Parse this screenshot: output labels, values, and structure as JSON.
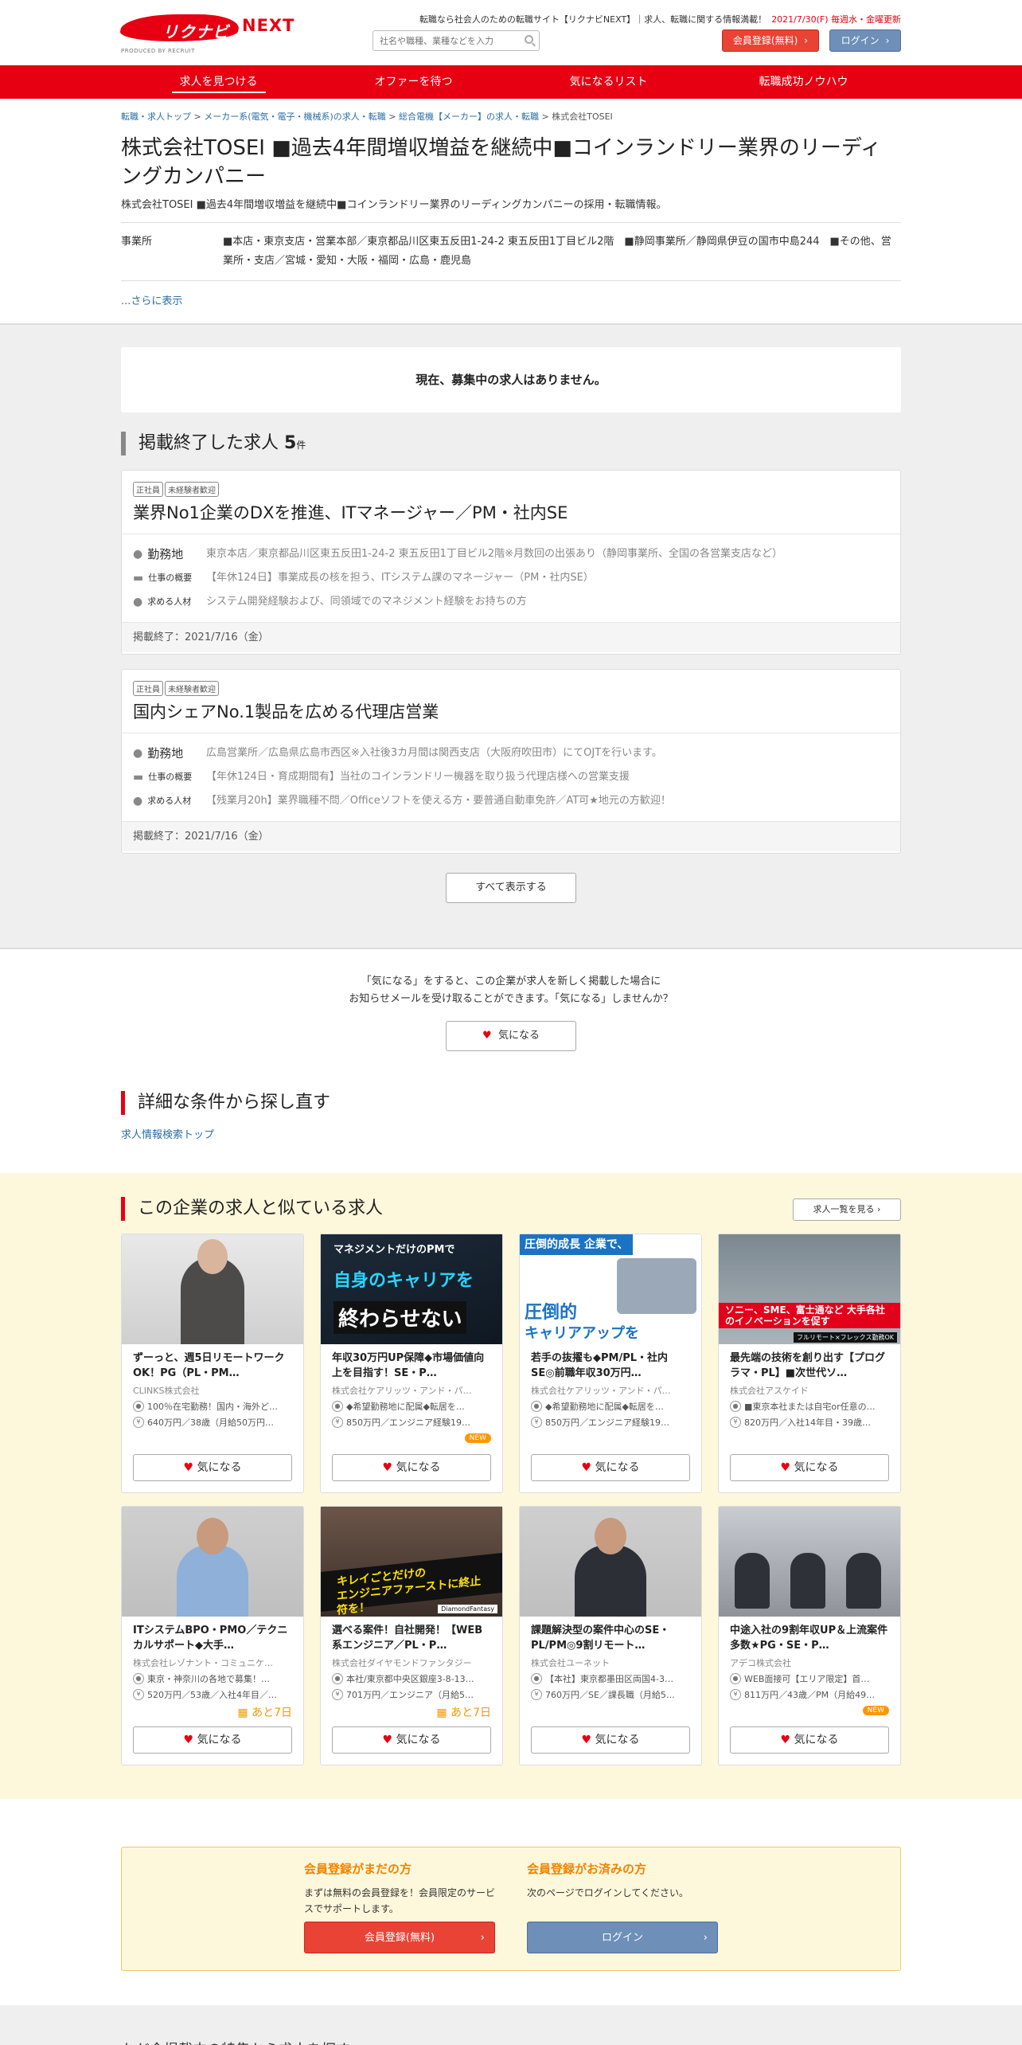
{
  "header": {
    "logo_text": "リクナビ",
    "logo_next": "NEXT",
    "logo_sub": "PRODUCED BY RECRUIT",
    "tagline": "転職なら社会人のための転職サイト【リクナビNEXT】｜求人、転職に関する情報満載！",
    "update": "2021/7/30(F) 毎週水・金曜更新",
    "search_placeholder": "社名や職種、業種などを入力",
    "register_label": "会員登録(無料)",
    "login_label": "ログイン"
  },
  "nav": [
    "求人を見つける",
    "オファーを待つ",
    "気になるリスト",
    "転職成功ノウハウ"
  ],
  "breadcrumb": {
    "items": [
      "転職・求人トップ",
      "メーカー系(電気・電子・機械系)の求人・転職",
      "総合電機【メーカー】の求人・転職"
    ],
    "current": "株式会社TOSEI"
  },
  "company": {
    "title": "株式会社TOSEI ■過去4年間増収増益を継続中■コインランドリー業界のリーディングカンパニー",
    "subtitle": "株式会社TOSEI ■過去4年間増収増益を継続中■コインランドリー業界のリーディングカンパニーの採用・転職情報。",
    "office_label": "事業所",
    "office_value": "■本店・東京支店・営業本部／東京都品川区東五反田1-24-2 東五反田1丁目ビル2階　■静岡事業所／静岡県伊豆の国市中島244　■その他、営業所・支店／宮城・愛知・大阪・福岡・広島・鹿児島",
    "more_label": "...さらに表示"
  },
  "jobs": {
    "no_jobs": "現在、募集中の求人はありません。",
    "ended_title": "掲載終了した求人",
    "ended_count": "5",
    "ended_unit": "件",
    "labels": {
      "location": "勤務地",
      "overview": "仕事の概要",
      "seeking": "求める人材"
    },
    "items": [
      {
        "tags": [
          "正社員",
          "未経験者歓迎"
        ],
        "title": "業界No1企業のDXを推進、ITマネージャー／PM・社内SE",
        "location": "東京本店／東京都品川区東五反田1-24-2 東五反田1丁目ビル2階※月数回の出張あり（静岡事業所、全国の各営業支店など）",
        "overview": "【年休124日】事業成長の核を担う、ITシステム課のマネージャー（PM・社内SE）",
        "seeking": "システム開発経験および、同領域でのマネジメント経験をお持ちの方",
        "ended": "掲載終了：2021/7/16（金）"
      },
      {
        "tags": [
          "正社員",
          "未経験者歓迎"
        ],
        "title": "国内シェアNo.1製品を広める代理店営業",
        "location": "広島営業所／広島県広島市西区※入社後3カ月間は関西支店（大阪府吹田市）にてOJTを行います。",
        "overview": "【年休124日・育成期間有】当社のコインランドリー機器を取り扱う代理店様への営業支援",
        "seeking": "【残業月20h】業界職種不問／Officeソフトを使える方・要普通自動車免許／AT可★地元の方歓迎！",
        "ended": "掲載終了：2021/7/16（金）"
      }
    ],
    "show_all": "すべて表示する"
  },
  "favorite": {
    "line1": "「気になる」をすると、この企業が求人を新しく掲載した場合に",
    "line2": "お知らせメールを受け取ることができます。「気になる」しませんか？",
    "button": "気になる"
  },
  "detail_search": {
    "title": "詳細な条件から探し直す",
    "link": "求人情報検索トップ"
  },
  "similar": {
    "title": "この企業の求人と似ている求人",
    "list_button": "求人一覧を見る",
    "fav_label": "気になる",
    "cards": [
      {
        "title": "ずーっと、週5日リモートワークOK！PG（PL・PM…",
        "company": "CLINKS株式会社",
        "loc": "100％在宅勤務！国内・海外ど…",
        "salary": "640万円／38歳（月給50万円…",
        "badge": "",
        "days": ""
      },
      {
        "title": "年収30万円UP保障◆市場価値向上を目指す！SE・P…",
        "company": "株式会社ケアリッツ・アンド・パ…",
        "loc": "◆希望勤務地に配属◆転居を…",
        "salary": "850万円／エンジニア経験19…",
        "badge": "NEW",
        "days": "",
        "art": {
          "l1": "マネジメントだけのPMで",
          "l2": "自身のキャリアを",
          "l3": "終わらせない"
        }
      },
      {
        "title": "若手の抜擢も◆PM/PL・社内SE◎前職年収30万円…",
        "company": "株式会社ケアリッツ・アンド・パ…",
        "loc": "◆希望勤務地に配属◆転居を…",
        "salary": "850万円／エンジニア経験19…",
        "badge": "",
        "days": "",
        "art": {
          "l1": "圧倒的成長 企業で、",
          "l2": "圧倒的",
          "l3": "キャリアアップを"
        }
      },
      {
        "title": "最先端の技術を創り出す【プログラマ・PL】■次世代ソ…",
        "company": "株式会社アスケイド",
        "loc": "■東京本社または自宅or任意の…",
        "salary": "820万円／入社14年目・39歳…",
        "badge": "",
        "days": "",
        "art": {
          "band": "ソニー、SME、富士通など 大手各社のイノベーションを促す",
          "sm": "フルリモート×フレックス勤務OK"
        }
      },
      {
        "title": "ITシステムBPO・PMO／テクニカルサポート◆大手…",
        "company": "株式会社レゾナント・コミュニケ…",
        "loc": "東京・神奈川の各地で募集！…",
        "salary": "520万円／53歳／入社4年目／…",
        "badge": "",
        "days": "あと7日"
      },
      {
        "title": "選べる案件！自社開発！【WEB系エンジニア／PL・P…",
        "company": "株式会社ダイヤモンドファンタジー",
        "loc": "本社/東京都中央区銀座3-8-13…",
        "salary": "701万円／エンジニア（月給5…",
        "badge": "",
        "days": "あと7日",
        "art": {
          "a": "キレイごとだけの",
          "b": "エンジニアファーストに終止符を！",
          "logo": "DiamondFantasy"
        }
      },
      {
        "title": "課題解決型の案件中心のSE・PL/PM◎9割リモート…",
        "company": "株式会社ユーネット",
        "loc": "【本社】東京都墨田区両国4-3…",
        "salary": "760万円／SE／課長職（月給5…",
        "badge": "",
        "days": ""
      },
      {
        "title": "中途入社の9割年収UP＆上流案件多数★PG・SE・P…",
        "company": "アデコ株式会社",
        "loc": "WEB面接可【エリア限定】首…",
        "salary": "811万円／43歳／PM（月給49…",
        "badge": "NEW",
        "days": ""
      }
    ]
  },
  "member": {
    "new_title": "会員登録がまだの方",
    "new_text": "まずは無料の会員登録を！会員限定のサービスでサポートします。",
    "new_button": "会員登録(無料)",
    "exist_title": "会員登録がお済みの方",
    "exist_text": "次のページでログインしてください。",
    "exist_button": "ログイン"
  },
  "bottom_title": "ただ今掲載中の特集から求人を探す",
  "colors": {
    "brand": "#e60012",
    "accent_orange": "#f08300",
    "link": "#2a6ea6",
    "login_blue": "#6d8fb8"
  }
}
